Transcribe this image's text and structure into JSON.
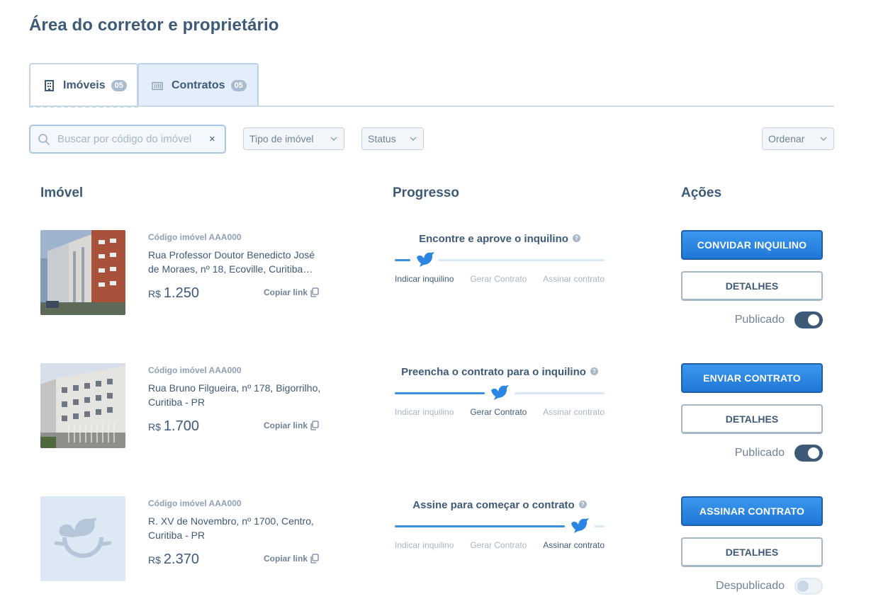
{
  "page": {
    "title": "Área do corretor e proprietário"
  },
  "tabs": [
    {
      "label": "Imóveis",
      "count": "05",
      "icon": "building-icon",
      "active": true
    },
    {
      "label": "Contratos",
      "count": "05",
      "icon": "contract-icon",
      "active": false
    }
  ],
  "filters": {
    "search_placeholder": "Buscar por código do imóvel",
    "search_value": "",
    "clear_label": "×",
    "tipo": "Tipo de imóvel",
    "status": "Status",
    "ordenar": "Ordenar"
  },
  "columns": {
    "imovel": "Imóvel",
    "progresso": "Progresso",
    "acoes": "Ações"
  },
  "progress_labels": [
    "Indicar inquilino",
    "Gerar Contrato",
    "Assinar contrato"
  ],
  "rows": [
    {
      "code": "Código imóvel AAA000",
      "address": "Rua Professor Doutor Benedicto José de Moraes, nº 18, Ecoville, Curitiba…",
      "currency": "R$",
      "price": "1.250",
      "copy_label": "Copiar link",
      "step_title": "Encontre e aprove o inquilino",
      "step_index": 0,
      "primary_action": "CONVIDAR INQUILINO",
      "secondary_action": "DETALHES",
      "publish_label": "Publicado",
      "published": true,
      "image": "building-photo"
    },
    {
      "code": "Código imóvel AAA000",
      "address": "Rua Bruno Filgueira, nº 178, Bigorrilho, Curitiba - PR",
      "currency": "R$",
      "price": "1.700",
      "copy_label": "Copiar link",
      "step_title": "Preencha o contrato para o inquilino",
      "step_index": 1,
      "primary_action": "ENVIAR CONTRATO",
      "secondary_action": "DETALHES",
      "publish_label": "Publicado",
      "published": true,
      "image": "building-photo"
    },
    {
      "code": "Código imóvel AAA000",
      "address": "R. XV de Novembro, nº 1700, Centro, Curitiba - PR",
      "currency": "R$",
      "price": "2.370",
      "copy_label": "Copiar link",
      "step_title": "Assine para começar o contrato",
      "step_index": 2,
      "primary_action": "ASSINAR CONTRATO",
      "secondary_action": "DETALHES",
      "publish_label": "Despublicado",
      "published": false,
      "image": "placeholder-image"
    }
  ],
  "colors": {
    "accent": "#2a86e2",
    "dark": "#3d5a78",
    "muted": "#a6b5c5"
  }
}
